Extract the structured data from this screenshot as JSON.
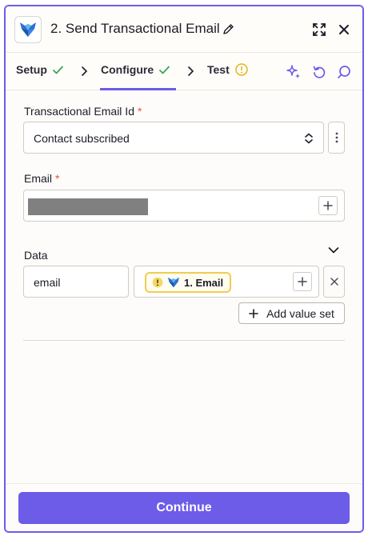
{
  "header": {
    "title": "2. Send Transactional Email",
    "logo_icon": "fox-logo-icon",
    "actions": [
      "expand-icon",
      "close-icon"
    ]
  },
  "tabs": [
    {
      "label": "Setup",
      "status": "complete"
    },
    {
      "label": "Configure",
      "status": "complete",
      "active": true
    },
    {
      "label": "Test",
      "status": "warning"
    }
  ],
  "tab_tools": [
    "sparkle-icon",
    "undo-icon",
    "search-icon"
  ],
  "form": {
    "transactional_email_id": {
      "label": "Transactional Email Id",
      "required_mark": "*",
      "value": "Contact subscribed"
    },
    "email": {
      "label": "Email",
      "required_mark": "*",
      "value_redacted": true
    },
    "data": {
      "label": "Data",
      "rows": [
        {
          "key": "email",
          "value_pill": "1. Email"
        }
      ],
      "add_value_set_label": "Add value set"
    }
  },
  "footer": {
    "continue_label": "Continue"
  },
  "colors": {
    "accent": "#6d5ce8",
    "success": "#3aa55c",
    "warning": "#e8b31a",
    "required": "#e5533d"
  }
}
